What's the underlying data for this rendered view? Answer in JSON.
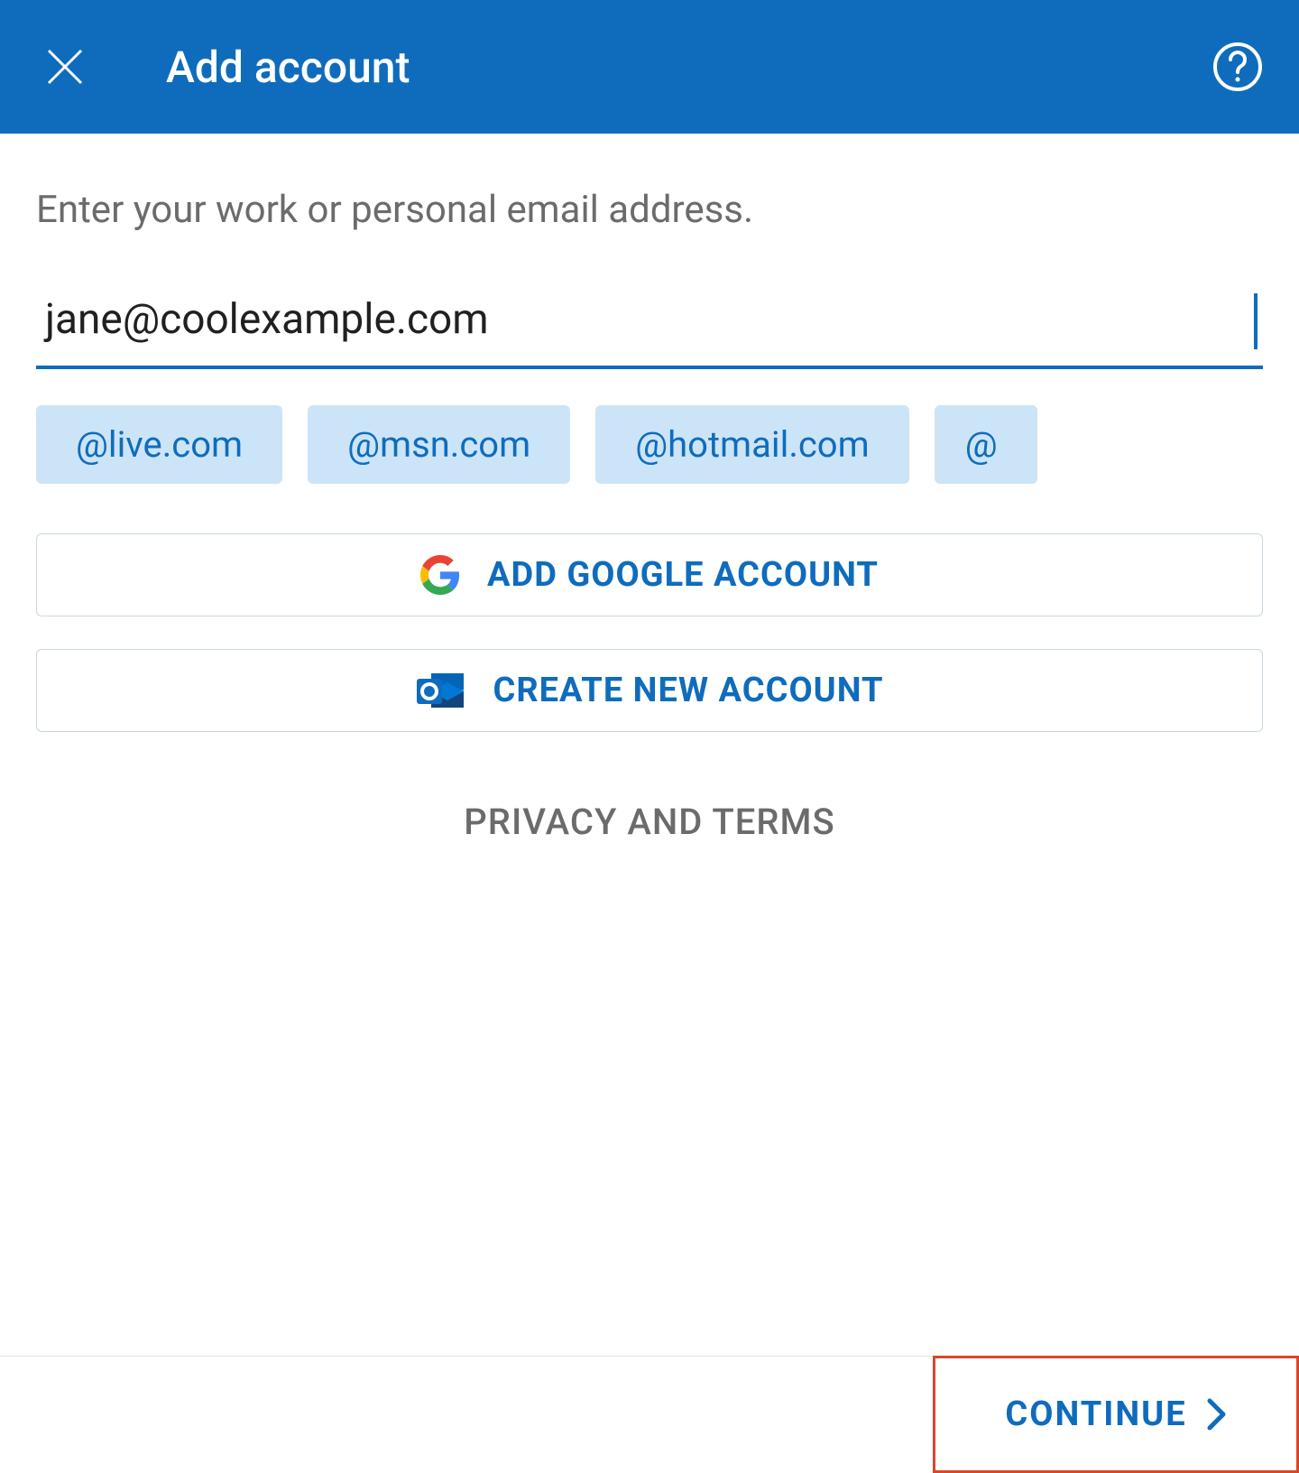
{
  "header": {
    "title": "Add account"
  },
  "prompt": "Enter your work or personal email address.",
  "email": {
    "value": "jane@coolexample.com"
  },
  "suggestions": [
    "@live.com",
    "@msn.com",
    "@hotmail.com",
    "@"
  ],
  "buttons": {
    "google": "ADD GOOGLE ACCOUNT",
    "create": "CREATE NEW ACCOUNT",
    "continue": "CONTINUE"
  },
  "links": {
    "privacy": "PRIVACY AND TERMS"
  },
  "colors": {
    "primary": "#0f6cbd",
    "highlight": "#d9472b",
    "chipBg": "#cce4f7",
    "muted": "#6b6b6b"
  }
}
